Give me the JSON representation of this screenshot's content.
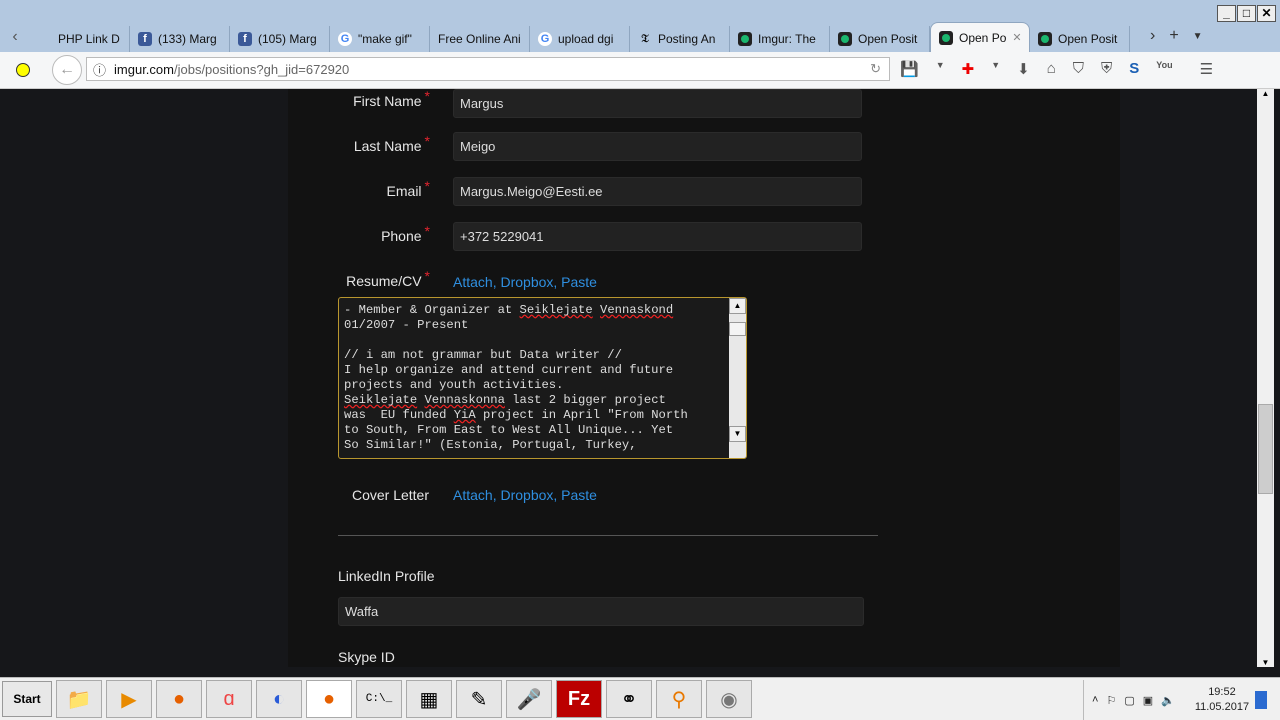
{
  "browser": {
    "tabs": [
      {
        "label": "PHP Link D",
        "icon": "php-icon"
      },
      {
        "label": "(133) Marg",
        "icon": "facebook-icon"
      },
      {
        "label": "(105) Marg",
        "icon": "facebook-icon"
      },
      {
        "label": "\"make gif\"",
        "icon": "google-icon"
      },
      {
        "label": "Free Online Ani",
        "icon": "none"
      },
      {
        "label": "upload dgi",
        "icon": "google-icon"
      },
      {
        "label": "Posting An",
        "icon": "nyt-icon"
      },
      {
        "label": "Imgur: The",
        "icon": "imgur-icon"
      },
      {
        "label": "Open Posit",
        "icon": "imgur-icon"
      },
      {
        "label": "Open Po",
        "icon": "imgur-icon",
        "active": true
      },
      {
        "label": "Open Posit",
        "icon": "imgur-icon"
      }
    ],
    "url_host": "imgur.com",
    "url_path": "/jobs/positions?gh_jid=672920"
  },
  "form": {
    "first_name_label": "First Name",
    "first_name": "Margus",
    "last_name_label": "Last Name",
    "last_name": "Meigo",
    "email_label": "Email",
    "email": "Margus.Meigo@Eesti.ee",
    "phone_label": "Phone",
    "phone": "+372 5229041",
    "required_mark": "*",
    "resume_label": "Resume/CV",
    "resume_links": "Attach, Dropbox, Paste",
    "resume_text": [
      "- Member & Organizer at Seiklejate Vennaskond",
      "01/2007 - Present",
      "",
      "// i am not grammar but Data writer //",
      "I help organize and attend current and future",
      "projects and youth activities.",
      "Seiklejate Vennaskonna last 2 bigger project",
      "was  EU funded YiA project in April \"From North",
      "to South, From East to West All Unique... Yet",
      "So Similar!\" (Estonia, Portugal, Turkey,"
    ],
    "cover_label": "Cover Letter",
    "cover_links": "Attach, Dropbox, Paste",
    "linkedin_label": "LinkedIn Profile",
    "linkedin": "Waffa",
    "skype_label": "Skype ID"
  },
  "taskbar": {
    "start": "Start",
    "time": "19:52",
    "date": "11.05.2017"
  }
}
